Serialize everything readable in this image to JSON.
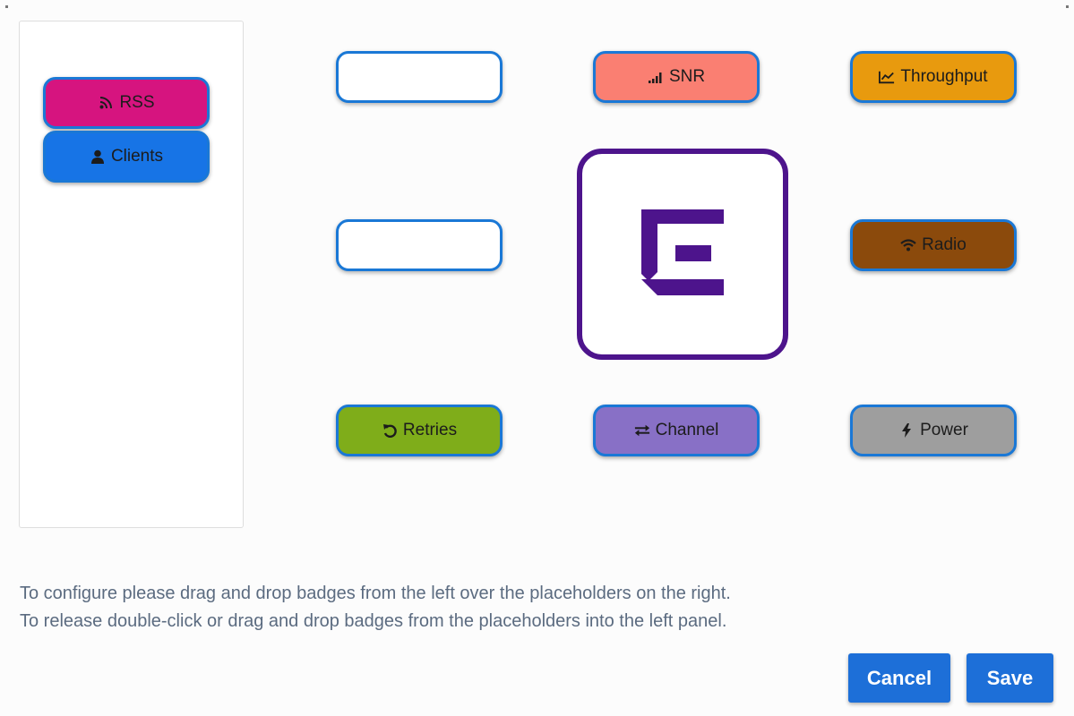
{
  "left_panel": {
    "badges": [
      {
        "label": "RSS",
        "icon": "rss-icon",
        "color": "#d6147f"
      },
      {
        "label": "Clients",
        "icon": "user-icon",
        "color": "#1774e6"
      }
    ]
  },
  "grid": {
    "snr": {
      "label": "SNR",
      "icon": "signal-bars-icon",
      "color": "#fa7f72"
    },
    "throughput": {
      "label": "Throughput",
      "icon": "line-chart-icon",
      "color": "#e89a0e"
    },
    "radio": {
      "label": "Radio",
      "icon": "wifi-icon",
      "color": "#8b4a0c"
    },
    "retries": {
      "label": "Retries",
      "icon": "undo-icon",
      "color": "#7fad1a"
    },
    "channel": {
      "label": "Channel",
      "icon": "exchange-icon",
      "color": "#8870c6"
    },
    "power": {
      "label": "Power",
      "icon": "bolt-icon",
      "color": "#9e9e9e"
    }
  },
  "logo": {
    "icon": "extreme-logo-icon",
    "color": "#4d148c"
  },
  "instructions": {
    "line1": "To configure please drag and drop badges from the left over the placeholders on the right.",
    "line2": "To release double-click or drag and drop badges from the placeholders into the left panel."
  },
  "actions": {
    "cancel_label": "Cancel",
    "save_label": "Save",
    "button_color": "#1d6fd8"
  }
}
